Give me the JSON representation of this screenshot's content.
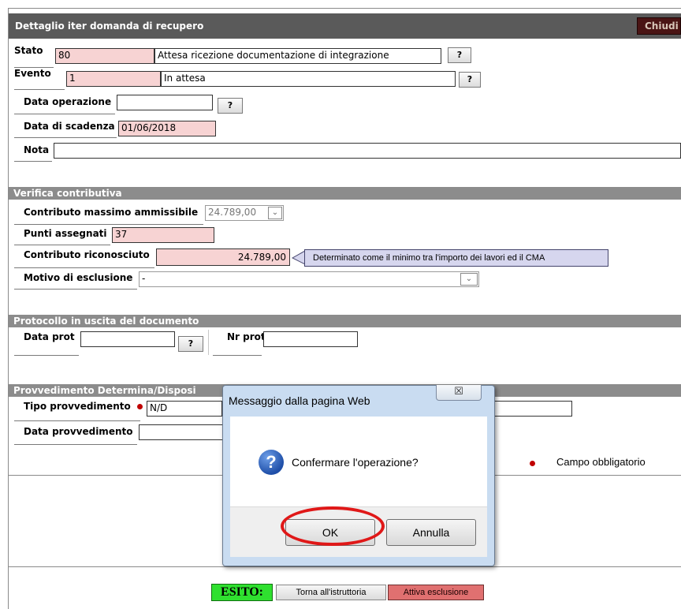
{
  "header": {
    "title": "Dettaglio iter domanda di recupero",
    "close_label": "Chiudi"
  },
  "stato": {
    "label": "Stato",
    "code": "80",
    "description": "Attesa ricezione documentazione di integrazione",
    "help": "?"
  },
  "evento": {
    "label": "Evento",
    "code": "1",
    "description": "In attesa",
    "help": "?"
  },
  "data_operazione": {
    "label": "Data operazione",
    "value": "",
    "help": "?"
  },
  "data_scadenza": {
    "label": "Data di scadenza",
    "value": "01/06/2018"
  },
  "nota": {
    "label": "Nota",
    "value": ""
  },
  "verifica": {
    "title": "Verifica contributiva",
    "contributo_massimo": {
      "label": "Contributo massimo ammissibile",
      "value": "24.789,00"
    },
    "punti": {
      "label": "Punti assegnati",
      "value": "37"
    },
    "contributo_riconosciuto": {
      "label": "Contributo riconosciuto",
      "value": "24.789,00",
      "tooltip": "Determinato come il minimo tra l'importo dei lavori ed il CMA"
    },
    "motivo": {
      "label": "Motivo di esclusione",
      "value": "-"
    }
  },
  "protocollo": {
    "title": "Protocollo in uscita del documento",
    "data_label": "Data prot",
    "data_value": "",
    "help": "?",
    "nr_label": "Nr prot",
    "nr_value": ""
  },
  "provvedimento": {
    "title": "Provvedimento Determina/Disposi",
    "tipo_label": "Tipo provvedimento",
    "tipo_value": "N/D",
    "data_label": "Data provvedimento",
    "data_value": ""
  },
  "legend": {
    "mandatory": "Campo obbligatorio"
  },
  "footer": {
    "esito": "ESITO:",
    "torna": "Torna all'istruttoria",
    "attiva": "Attiva esclusione"
  },
  "dialog": {
    "title": "Messaggio dalla pagina Web",
    "close": "☒",
    "message": "Confermare l'operazione?",
    "ok": "OK",
    "cancel": "Annulla"
  },
  "colors": {
    "required_field": "#f7d3d3",
    "section_bar": "#8c8c8c",
    "title_bar": "#5a5a5a",
    "esito_green": "#2fe02f",
    "attiva_red": "#e07070",
    "highlight_circle": "#e01818"
  }
}
